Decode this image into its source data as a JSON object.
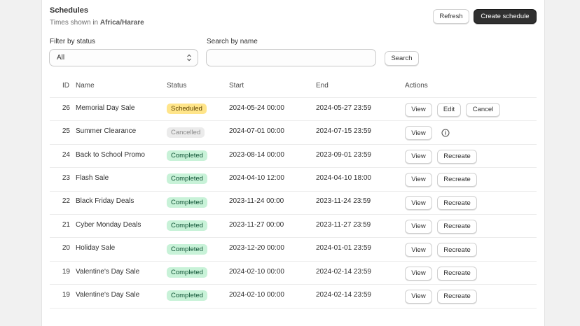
{
  "header": {
    "title": "Schedules",
    "subtitle_prefix": "Times shown in",
    "timezone": "Africa/Harare",
    "refresh_label": "Refresh",
    "create_label": "Create schedule"
  },
  "filters": {
    "status_label": "Filter by status",
    "status_value": "All",
    "search_label": "Search by name",
    "search_value": "",
    "search_placeholder": "",
    "search_button": "Search"
  },
  "table": {
    "columns": [
      "ID",
      "Name",
      "Status",
      "Start",
      "End",
      "Actions"
    ],
    "rows": [
      {
        "id": "26",
        "name": "Memorial Day Sale",
        "status": "Scheduled",
        "start": "2024-05-24 00:00",
        "end": "2024-05-27 23:59",
        "actions": [
          "View",
          "Edit",
          "Cancel"
        ]
      },
      {
        "id": "25",
        "name": "Summer Clearance",
        "status": "Cancelled",
        "start": "2024-07-01 00:00",
        "end": "2024-07-15 23:59",
        "actions": [
          "View"
        ],
        "info_icon": true
      },
      {
        "id": "24",
        "name": "Back to School Promo",
        "status": "Completed",
        "start": "2023-08-14 00:00",
        "end": "2023-09-01 23:59",
        "actions": [
          "View",
          "Recreate"
        ]
      },
      {
        "id": "23",
        "name": "Flash Sale",
        "status": "Completed",
        "start": "2024-04-10 12:00",
        "end": "2024-04-10 18:00",
        "actions": [
          "View",
          "Recreate"
        ]
      },
      {
        "id": "22",
        "name": "Black Friday Deals",
        "status": "Completed",
        "start": "2023-11-24 00:00",
        "end": "2023-11-24 23:59",
        "actions": [
          "View",
          "Recreate"
        ]
      },
      {
        "id": "21",
        "name": "Cyber Monday Deals",
        "status": "Completed",
        "start": "2023-11-27 00:00",
        "end": "2023-11-27 23:59",
        "actions": [
          "View",
          "Recreate"
        ]
      },
      {
        "id": "20",
        "name": "Holiday Sale",
        "status": "Completed",
        "start": "2023-12-20 00:00",
        "end": "2024-01-01 23:59",
        "actions": [
          "View",
          "Recreate"
        ]
      },
      {
        "id": "19",
        "name": "Valentine's Day Sale",
        "status": "Completed",
        "start": "2024-02-10 00:00",
        "end": "2024-02-14 23:59",
        "actions": [
          "View",
          "Recreate"
        ]
      },
      {
        "id": "19",
        "name": "Valentine's Day Sale",
        "status": "Completed",
        "start": "2024-02-10 00:00",
        "end": "2024-02-14 23:59",
        "actions": [
          "View",
          "Recreate"
        ]
      }
    ]
  },
  "status_colors": {
    "Scheduled": {
      "bg": "#ffe58a",
      "fg": "#5e4200"
    },
    "Cancelled": {
      "bg": "#ebebeb",
      "fg": "#8a8a8a"
    },
    "Completed": {
      "bg": "#c8f2d8",
      "fg": "#0c5132"
    }
  },
  "icons": {
    "select_chevron": "chevron-updown-icon",
    "row_info": "info-circle-icon"
  }
}
